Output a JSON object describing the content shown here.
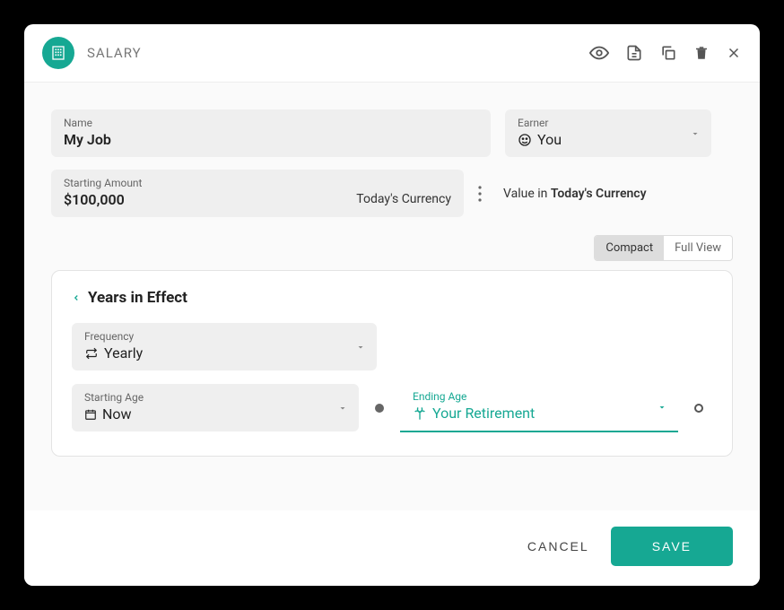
{
  "header": {
    "title": "SALARY"
  },
  "fields": {
    "name_label": "Name",
    "name_value": "My Job",
    "earner_label": "Earner",
    "earner_value": "You",
    "amount_label": "Starting Amount",
    "amount_value": "$100,000",
    "currency_tag": "Today's Currency",
    "value_in_prefix": "Value in ",
    "value_in_strong": "Today's Currency"
  },
  "toggle": {
    "compact": "Compact",
    "full": "Full View"
  },
  "card": {
    "title": "Years in Effect",
    "freq_label": "Frequency",
    "freq_value": "Yearly",
    "start_label": "Starting Age",
    "start_value": "Now",
    "end_label": "Ending Age",
    "end_value": "Your Retirement"
  },
  "footer": {
    "cancel": "CANCEL",
    "save": "SAVE"
  }
}
